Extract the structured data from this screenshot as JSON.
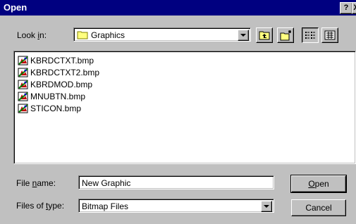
{
  "window": {
    "title": "Open",
    "help_label": "?",
    "close_label": "X"
  },
  "look_in": {
    "label_pre": "Look ",
    "label_mnemonic": "i",
    "label_post": "n:",
    "value": "Graphics"
  },
  "toolbar": {
    "icons": [
      "up-one-level-icon",
      "create-new-folder-icon",
      "list-view-icon",
      "details-view-icon"
    ]
  },
  "files": [
    {
      "name": "KBRDCTXT.bmp"
    },
    {
      "name": "KBRDCTXT2.bmp"
    },
    {
      "name": "KBRDMOD.bmp"
    },
    {
      "name": "MNUBTN.bmp"
    },
    {
      "name": "STICON.bmp"
    }
  ],
  "file_name": {
    "label_pre": "File ",
    "label_mnemonic": "n",
    "label_post": "ame:",
    "value": "New Graphic"
  },
  "file_type": {
    "label_pre": "Files of ",
    "label_mnemonic": "t",
    "label_post": "ype:",
    "value": "Bitmap Files"
  },
  "buttons": {
    "open_mnemonic": "O",
    "open_rest": "pen",
    "cancel": "Cancel"
  },
  "colors": {
    "title_bar": "#000080",
    "face": "#c0c0c0",
    "folder": "#ffff80"
  }
}
